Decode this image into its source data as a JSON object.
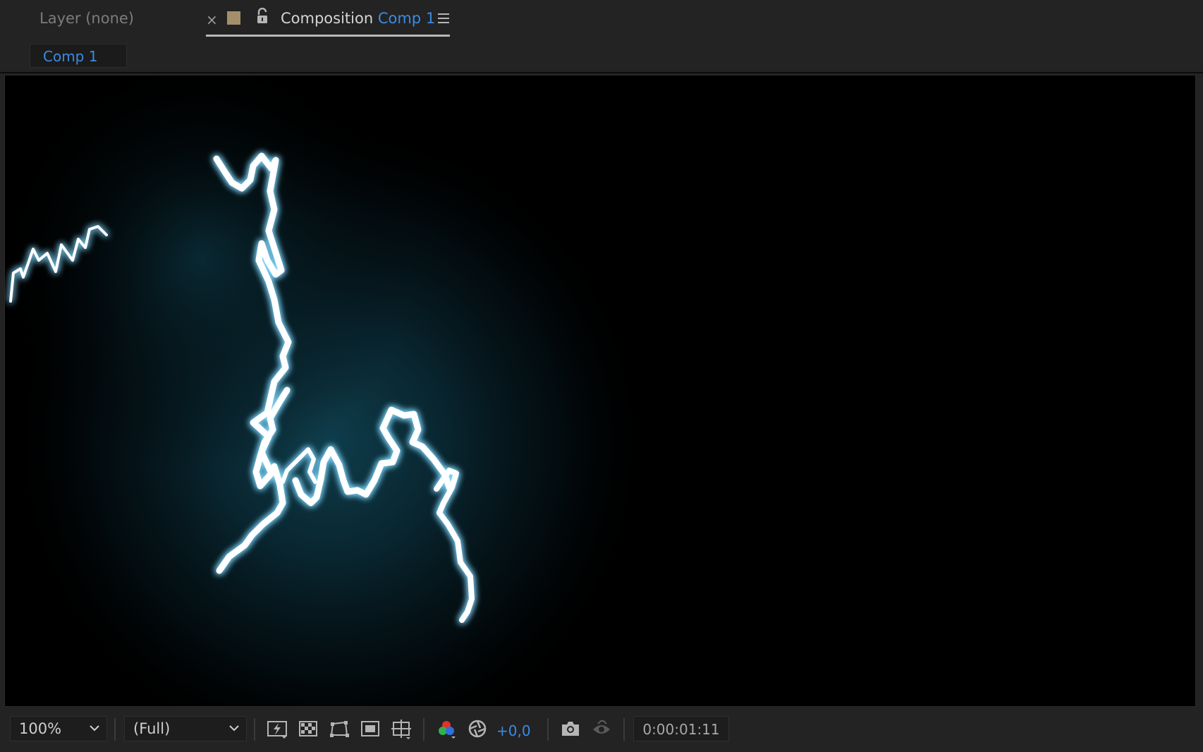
{
  "tabs": {
    "layer_tab": "Layer (none)",
    "comp_tab": {
      "prefix": "Composition",
      "name": "Comp 1",
      "close_symbol": "×"
    },
    "label_color": "#a38f6c"
  },
  "breadcrumb": {
    "label": "Comp 1"
  },
  "viewer": {
    "background": "#000000",
    "glow_color": "#0e3a48",
    "bolt_color": "#ffffff"
  },
  "footer": {
    "zoom": "100%",
    "resolution": "(Full)",
    "exposure": "+0,0",
    "timecode": "0:00:01:11",
    "icons": [
      "fast-previews-icon",
      "transparency-grid-icon",
      "mask-path-icon",
      "region-of-interest-icon",
      "guides-icon",
      "color-channels-icon",
      "reset-exposure-icon",
      "snapshot-camera-icon",
      "show-snapshot-icon"
    ]
  },
  "colors": {
    "accent": "#3a8be3",
    "panel": "#232323"
  }
}
